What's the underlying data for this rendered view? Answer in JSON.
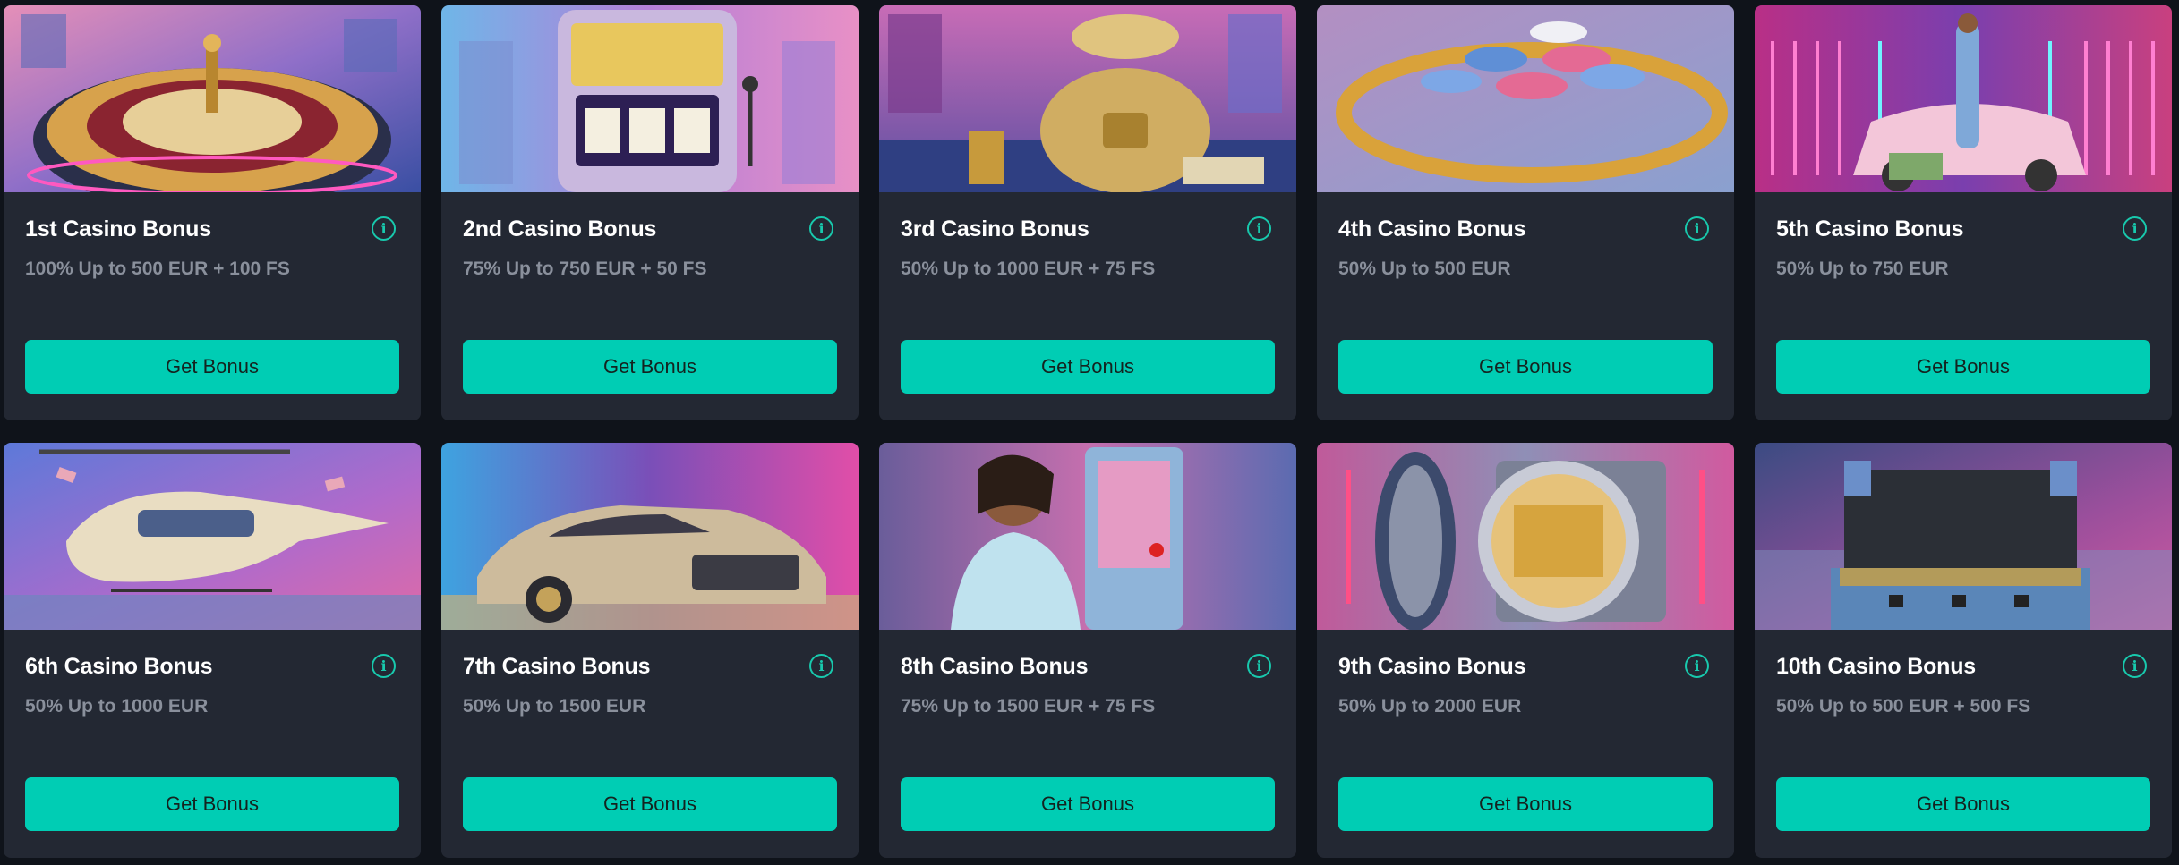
{
  "button_label": "Get Bonus",
  "colors": {
    "background": "#0f131a",
    "card": "#232833",
    "accent": "#00cdb4",
    "muted_text": "#8a909c"
  },
  "bonuses": [
    {
      "title": "1st Casino Bonus",
      "offer": "100% Up to 500 EUR + 100 FS",
      "art": "roulette-wheel"
    },
    {
      "title": "2nd Casino Bonus",
      "offer": "75% Up to 750 EUR + 50 FS",
      "art": "slot-machine"
    },
    {
      "title": "3rd Casino Bonus",
      "offer": "50% Up to 1000 EUR + 75 FS",
      "art": "gold-money-bag"
    },
    {
      "title": "4th Casino Bonus",
      "offer": "50% Up to 500 EUR",
      "art": "chips-and-gold-chain"
    },
    {
      "title": "5th Casino Bonus",
      "offer": "50% Up to 750 EUR",
      "art": "woman-with-sports-car"
    },
    {
      "title": "6th Casino Bonus",
      "offer": "50% Up to 1000 EUR",
      "art": "helicopter"
    },
    {
      "title": "7th Casino Bonus",
      "offer": "50% Up to 1500 EUR",
      "art": "luxury-car"
    },
    {
      "title": "8th Casino Bonus",
      "offer": "75% Up to 1500 EUR + 75 FS",
      "art": "woman-at-slot-machine"
    },
    {
      "title": "9th Casino Bonus",
      "offer": "50% Up to 2000 EUR",
      "art": "gold-vault"
    },
    {
      "title": "10th Casino Bonus",
      "offer": "50% Up to 500 EUR + 500 FS",
      "art": "treasure-suitcase"
    }
  ]
}
